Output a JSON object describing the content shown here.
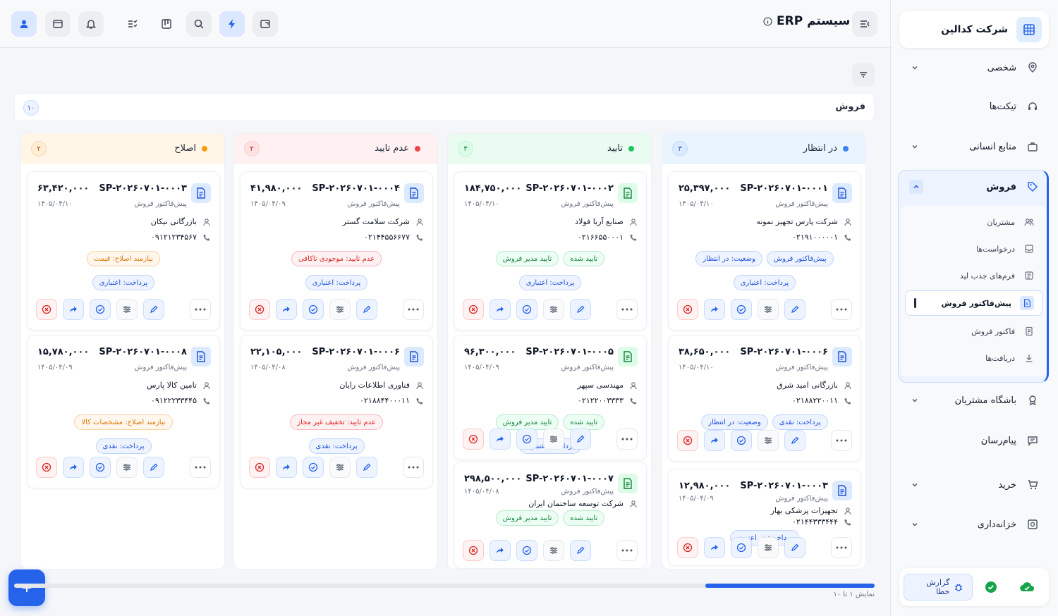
{
  "app": {
    "title": "سیستم ERP"
  },
  "company": {
    "name": "شرکت کدالین"
  },
  "sidebar": {
    "items": [
      {
        "label": "شخصی",
        "icon": "location-pin-icon"
      },
      {
        "label": "تیکت‌ها",
        "icon": "headset-icon"
      },
      {
        "label": "منابع انسانی",
        "icon": "briefcase-icon"
      },
      {
        "label": "فروش",
        "icon": "tag-icon"
      },
      {
        "label": "باشگاه مشتریان",
        "icon": "award-icon"
      },
      {
        "label": "پیام‌رسان",
        "icon": "chat-icon"
      },
      {
        "label": "خرید",
        "icon": "cart-icon"
      },
      {
        "label": "خزانه‌داری",
        "icon": "safe-icon"
      }
    ],
    "sales_sub": [
      {
        "label": "مشتریان",
        "icon": "users-icon"
      },
      {
        "label": "درخواست‌ها",
        "icon": "inbox-icon"
      },
      {
        "label": "فرم‌های جذب لید",
        "icon": "form-icon"
      },
      {
        "label": "پیش‌فاکتور فروش",
        "icon": "document-icon"
      },
      {
        "label": "فاکتور فروش",
        "icon": "invoice-icon"
      },
      {
        "label": "دریافت‌ها",
        "icon": "download-icon"
      }
    ],
    "error_report": "گزارش خطا"
  },
  "board": {
    "title": "فروش",
    "count": "۱۰",
    "showing": "نمایش ۱ تا ۱۰",
    "columns": [
      {
        "title": "در انتظار",
        "count": "۳",
        "color": "#3b82f6",
        "cards": [
          {
            "code": "SP-۲۰۲۶۰۷۰۱-۰۰۰۱",
            "amount": "۲۵,۳۹۷,۰۰۰",
            "type": "پیش‌فاکتور فروش",
            "date": "۱۴۰۵/۰۴/۱۰",
            "customer": "شرکت پارس تجهیز نمونه",
            "phone": "۰۲۱۹۱۰۰۰۰۰۱",
            "chips": [
              [
                "پیش‌فاکتور فروش",
                "blue"
              ],
              [
                "وضعیت: در انتظار",
                "blue"
              ]
            ],
            "payment": "پرداخت: اعتباری"
          },
          {
            "code": "SP-۲۰۲۶۰۷۰۱-۰۰۰۶",
            "amount": "۳۸,۶۵۰,۰۰۰",
            "type": "پیش‌فاکتور فروش",
            "date": "۱۴۰۵/۰۴/۱۰",
            "customer": "بازرگانی امید شرق",
            "phone": "۰۲۱۸۸۲۲۰۰۱۱",
            "chips": [
              [
                "پرداخت: نقدی",
                "blue"
              ],
              [
                "وضعیت: در انتظار",
                "blue"
              ]
            ],
            "payment": ""
          },
          {
            "code": "SP-۲۰۲۶۰۷۰۱-۰۰۰۳",
            "amount": "۱۲,۹۸۰,۰۰۰",
            "type": "پیش‌فاکتور فروش",
            "date": "۱۴۰۵/۰۴/۰۹",
            "customer": "تجهیزات پزشکی بهار",
            "phone": "۰۲۱۴۴۳۳۳۴۴۴",
            "chips": [],
            "payment": "پرداخت: در اعتبری"
          }
        ]
      },
      {
        "title": "تایید",
        "count": "۳",
        "color": "#22c55e",
        "cards": [
          {
            "code": "SP-۲۰۲۶۰۷۰۱-۰۰۰۲",
            "amount": "۱۸۴,۷۵۰,۰۰۰",
            "type": "پیش‌فاکتور فروش",
            "date": "۱۴۰۵/۰۴/۱۰",
            "customer": "صنایع آریا فولاد",
            "phone": "۰۲۱۶۶۵۵۰۰۰۱",
            "chips": [
              [
                "تایید شده",
                "green"
              ],
              [
                "تایید مدیر فروش",
                "green"
              ]
            ],
            "payment": "پرداخت: اعتباری"
          },
          {
            "code": "SP-۲۰۲۶۰۷۰۱-۰۰۰۵",
            "amount": "۹۶,۳۰۰,۰۰۰",
            "type": "پیش‌فاکتور فروش",
            "date": "۱۴۰۵/۰۴/۰۹",
            "customer": "مهندسی سپهر",
            "phone": "۰۲۱۲۲۰۰۳۳۳۳",
            "chips": [
              [
                "تایید شده",
                "green"
              ],
              [
                "تایید مدیر فروش",
                "green"
              ]
            ],
            "payment": "پرداخت: اعتباری"
          },
          {
            "code": "SP-۲۰۲۶۰۷۰۱-۰۰۰۷",
            "amount": "۲۹۸,۵۰۰,۰۰۰",
            "type": "پیش‌فاکتور فروش",
            "date": "۱۴۰۵/۰۴/۰۸",
            "customer": "شرکت توسعه ساختمان ایران",
            "phone": "",
            "chips": [
              [
                "تایید شده",
                "green"
              ],
              [
                "تایید مدیر فروش",
                "green"
              ]
            ],
            "payment": ""
          }
        ]
      },
      {
        "title": "عدم تایید",
        "count": "۲",
        "color": "#ef4444",
        "cards": [
          {
            "code": "SP-۲۰۲۶۰۷۰۱-۰۰۰۴",
            "amount": "۴۱,۹۸۰,۰۰۰",
            "type": "پیش‌فاکتور فروش",
            "date": "۱۴۰۵/۰۴/۰۹",
            "customer": "شرکت سلامت گستر",
            "phone": "۰۲۱۴۴۵۵۶۶۷۷",
            "chips": [
              [
                "عدم تایید: موجودی ناکافی",
                "red"
              ]
            ],
            "payment": "پرداخت: اعتباری"
          },
          {
            "code": "SP-۲۰۲۶۰۷۰۱-۰۰۰۶",
            "amount": "۲۲,۱۰۵,۰۰۰",
            "type": "پیش‌فاکتور فروش",
            "date": "۱۴۰۵/۰۴/۰۸",
            "customer": "فناوری اطلاعات رایان",
            "phone": "۰۲۱۸۸۴۴۰۰۰۱۱",
            "chips": [
              [
                "عدم تایید: تخفیف غیر مجاز",
                "red"
              ]
            ],
            "payment": "پرداخت: نقدی"
          }
        ]
      },
      {
        "title": "اصلاح",
        "count": "۲",
        "color": "#f59e0b",
        "cards": [
          {
            "code": "SP-۲۰۲۶۰۷۰۱-۰۰۰۳",
            "amount": "۶۳,۴۲۰,۰۰۰",
            "type": "پیش‌فاکتور فروش",
            "date": "۱۴۰۵/۰۴/۱۰",
            "customer": "بازرگانی نیکان",
            "phone": "۰۹۱۲۱۲۳۴۵۶۷",
            "chips": [
              [
                "نیازمند اصلاح: قیمت",
                "orange"
              ]
            ],
            "payment": "پرداخت: اعتباری"
          },
          {
            "code": "SP-۲۰۲۶۰۷۰۱-۰۰۰۸",
            "amount": "۱۵,۷۸۰,۰۰۰",
            "type": "پیش‌فاکتور فروش",
            "date": "۱۴۰۵/۰۴/۰۹",
            "customer": "تامین کالا پارس",
            "phone": "۰۹۱۲۲۲۳۳۴۴۵",
            "chips": [
              [
                "نیازمند اصلاح: مشخصات کالا",
                "orange"
              ]
            ],
            "payment": "پرداخت: نقدی"
          }
        ]
      }
    ]
  }
}
